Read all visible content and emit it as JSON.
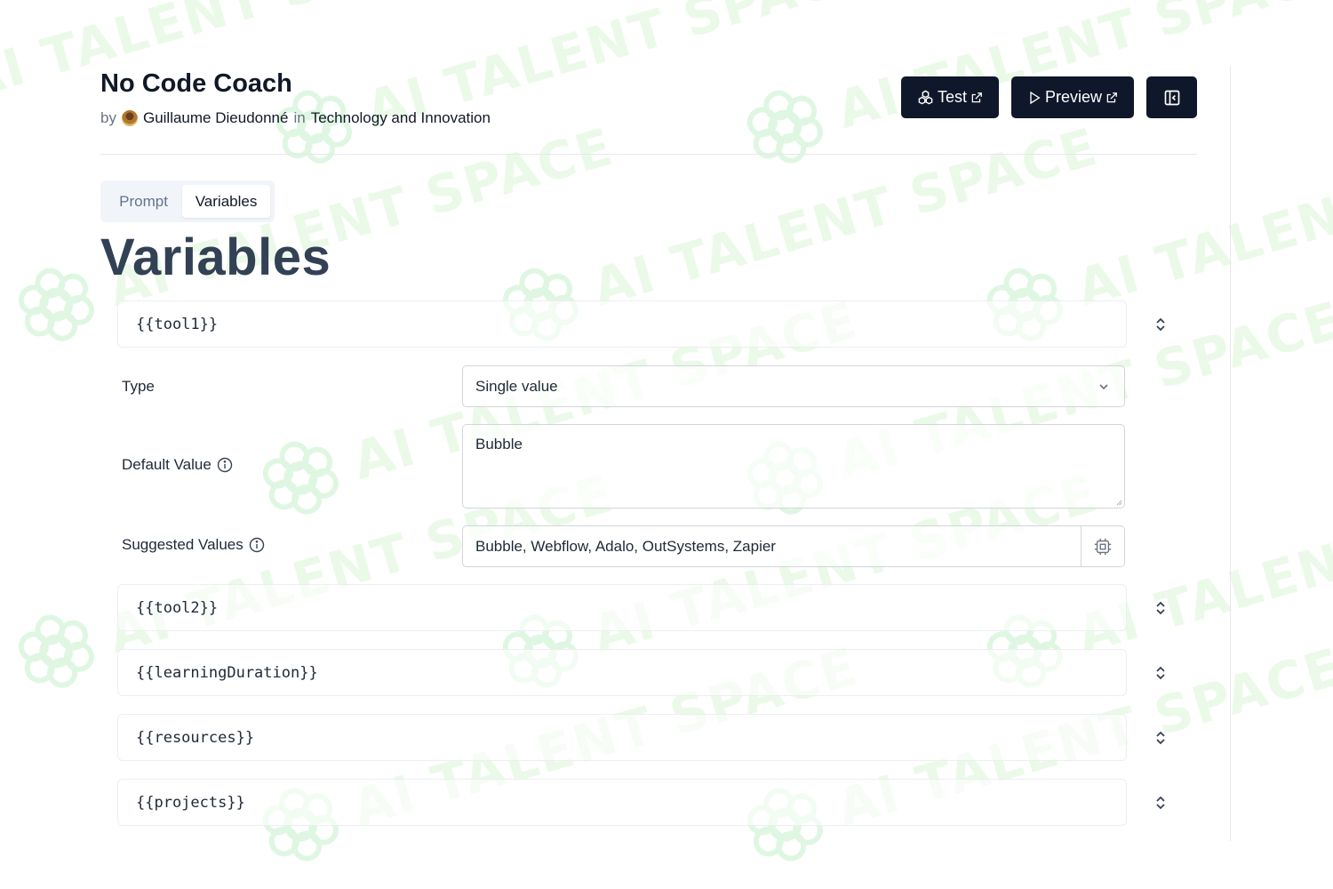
{
  "header": {
    "title": "No Code Coach",
    "by_prefix": "by",
    "author": "Guillaume Dieudonné",
    "in_word": "in",
    "category": "Technology and Innovation"
  },
  "toolbar": {
    "test_label": "Test",
    "preview_label": "Preview"
  },
  "tabs": [
    {
      "label": "Prompt",
      "active": false
    },
    {
      "label": "Variables",
      "active": true
    }
  ],
  "section_title": "Variables",
  "variables": [
    {
      "name": "{{tool1}}",
      "expanded": true
    },
    {
      "name": "{{tool2}}",
      "expanded": false
    },
    {
      "name": "{{learningDuration}}",
      "expanded": false
    },
    {
      "name": "{{resources}}",
      "expanded": false
    },
    {
      "name": "{{projects}}",
      "expanded": false
    }
  ],
  "expanded_variable": {
    "type_label": "Type",
    "type_value": "Single value",
    "default_label": "Default Value",
    "default_value": "Bubble",
    "suggested_label": "Suggested Values",
    "suggested_value": "Bubble, Webflow, Adalo, OutSystems, Zapier"
  },
  "watermark": {
    "text": "AI TALENT SPACE",
    "color": "#b8f0b0"
  },
  "colors": {
    "button_bg": "#0f172a",
    "heading": "#334155",
    "muted": "#6b7280"
  },
  "icons": [
    "test-icon",
    "external-link-icon",
    "play-icon",
    "sidebar-collapse-icon",
    "chevron-up-down-icon",
    "chevron-down-icon",
    "info-icon",
    "chip-icon"
  ]
}
